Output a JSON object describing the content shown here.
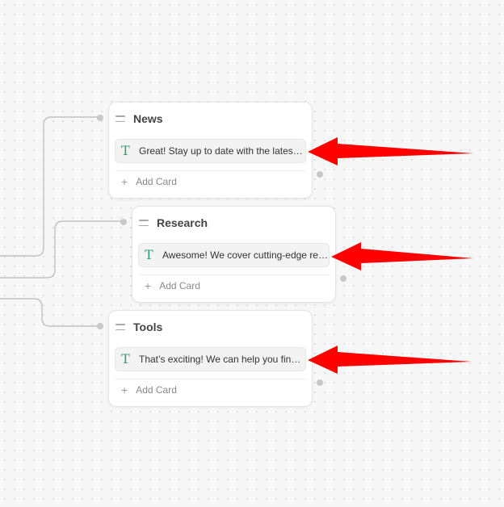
{
  "nodes": [
    {
      "title": "News",
      "card_text": "Great! Stay up to date with the latest news",
      "add_label": "Add Card",
      "type_icon": "T"
    },
    {
      "title": "Research",
      "card_text": "Awesome! We cover cutting-edge research",
      "add_label": "Add Card",
      "type_icon": "T"
    },
    {
      "title": "Tools",
      "card_text": "That’s exciting! We can help you find tools",
      "add_label": "Add Card",
      "type_icon": "T"
    }
  ],
  "icons": {
    "add": "plus-icon",
    "card_type": "text-type-icon",
    "drag": "drag-handle-icon",
    "annotation": "red-arrow"
  },
  "colors": {
    "annotation_arrow": "#ff0000",
    "text_type_icon": "#2f9e6a"
  }
}
